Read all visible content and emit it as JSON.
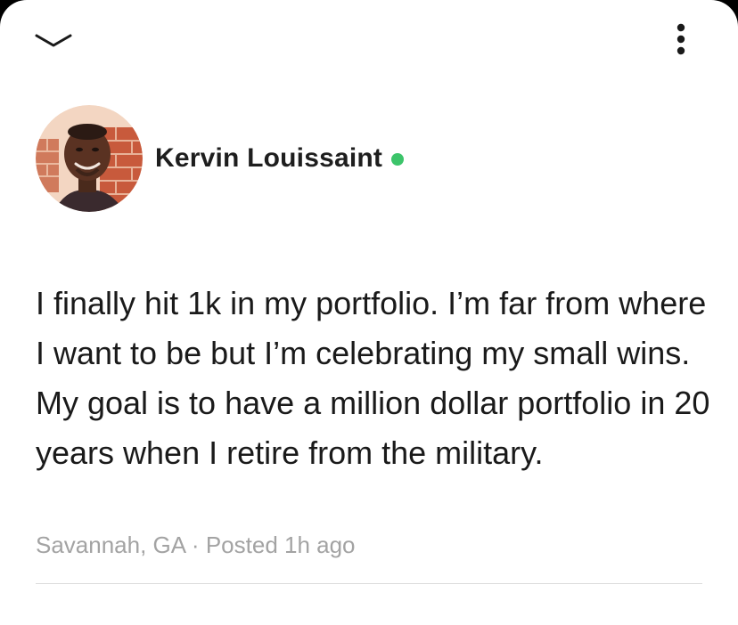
{
  "header": {
    "collapse_icon": "chevron-down-icon",
    "more_icon": "more-vertical-icon"
  },
  "post": {
    "author": {
      "name": "Kervin Louissaint",
      "online": true,
      "status_color": "#3cc46a",
      "avatar_icon": "avatar-photo"
    },
    "body": "I finally hit 1k in my portfolio. I’m far from where I want to be but I’m celebrating my small wins. My goal is to have a million dollar portfolio in 20 years when I retire from the military.",
    "location": "Savannah, GA",
    "separator": "·",
    "posted": "Posted 1h ago"
  }
}
